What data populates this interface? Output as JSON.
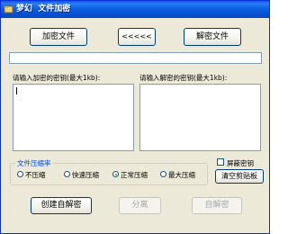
{
  "window": {
    "title": "梦幻  文件加密"
  },
  "toolbar": {
    "encrypt_file_label": "加密文件",
    "arrows_label": "<<<<<",
    "decrypt_file_label": "解密文件"
  },
  "file_path": {
    "value": ""
  },
  "encrypt_key": {
    "label": "请输入加密的密钥(最大1kb):",
    "value": ""
  },
  "decrypt_key": {
    "label": "请输入解密的密钥(最大1kb):",
    "value": ""
  },
  "compression": {
    "title": "文件压缩率",
    "options": [
      {
        "label": "不压缩",
        "checked": false
      },
      {
        "label": "快速压缩",
        "checked": false
      },
      {
        "label": "正常压缩",
        "checked": true
      },
      {
        "label": "最大压缩",
        "checked": false
      }
    ]
  },
  "hide_key": {
    "label": "屏蔽密钥",
    "checked": false
  },
  "clear_clipboard_label": "清空剪贴板",
  "bottom": {
    "create_self_decrypt_label": "创建自解密",
    "separate_label": "分离",
    "self_decrypt_label": "自解密"
  }
}
